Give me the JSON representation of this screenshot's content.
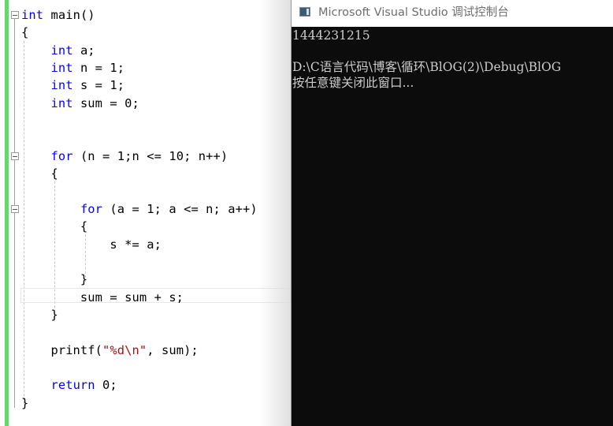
{
  "editor": {
    "lines": [
      {
        "id": "l1",
        "parts": [
          {
            "t": "int",
            "c": "kw"
          },
          {
            "t": " main()",
            "c": ""
          }
        ]
      },
      {
        "id": "l2",
        "parts": [
          {
            "t": "{",
            "c": ""
          }
        ]
      },
      {
        "id": "l3",
        "parts": [
          {
            "t": "    ",
            "c": ""
          },
          {
            "t": "int",
            "c": "kw"
          },
          {
            "t": " a;",
            "c": ""
          }
        ]
      },
      {
        "id": "l4",
        "parts": [
          {
            "t": "    ",
            "c": ""
          },
          {
            "t": "int",
            "c": "kw"
          },
          {
            "t": " n = 1;",
            "c": ""
          }
        ]
      },
      {
        "id": "l5",
        "parts": [
          {
            "t": "    ",
            "c": ""
          },
          {
            "t": "int",
            "c": "kw"
          },
          {
            "t": " s = 1;",
            "c": ""
          }
        ]
      },
      {
        "id": "l6",
        "parts": [
          {
            "t": "    ",
            "c": ""
          },
          {
            "t": "int",
            "c": "kw"
          },
          {
            "t": " sum = 0;",
            "c": ""
          }
        ]
      },
      {
        "id": "l7",
        "parts": []
      },
      {
        "id": "l8",
        "parts": []
      },
      {
        "id": "l9",
        "parts": [
          {
            "t": "    ",
            "c": ""
          },
          {
            "t": "for",
            "c": "kw"
          },
          {
            "t": " (n = 1;n <= 10; n++)",
            "c": ""
          }
        ]
      },
      {
        "id": "l10",
        "parts": [
          {
            "t": "    {",
            "c": ""
          }
        ]
      },
      {
        "id": "l11",
        "parts": []
      },
      {
        "id": "l12",
        "parts": [
          {
            "t": "        ",
            "c": ""
          },
          {
            "t": "for",
            "c": "kw"
          },
          {
            "t": " (a = 1; a <= n; a++)",
            "c": ""
          }
        ]
      },
      {
        "id": "l13",
        "parts": [
          {
            "t": "        {",
            "c": ""
          }
        ]
      },
      {
        "id": "l14",
        "parts": [
          {
            "t": "            s *= a;",
            "c": ""
          }
        ]
      },
      {
        "id": "l15",
        "parts": []
      },
      {
        "id": "l16",
        "parts": [
          {
            "t": "        }",
            "c": ""
          }
        ]
      },
      {
        "id": "l17",
        "parts": [
          {
            "t": "        sum = sum + s;",
            "c": ""
          }
        ]
      },
      {
        "id": "l18",
        "parts": [
          {
            "t": "    }",
            "c": ""
          }
        ]
      },
      {
        "id": "l19",
        "parts": []
      },
      {
        "id": "l20",
        "parts": [
          {
            "t": "    printf(",
            "c": ""
          },
          {
            "t": "\"%d\\n\"",
            "c": "str"
          },
          {
            "t": ", sum);",
            "c": ""
          }
        ]
      },
      {
        "id": "l21",
        "parts": []
      },
      {
        "id": "l22",
        "parts": [
          {
            "t": "    ",
            "c": ""
          },
          {
            "t": "return",
            "c": "kw"
          },
          {
            "t": " 0;",
            "c": ""
          }
        ]
      },
      {
        "id": "l23",
        "parts": [
          {
            "t": "}",
            "c": ""
          }
        ]
      }
    ],
    "colors": {
      "keyword": "#0000ff",
      "string": "#a31515",
      "change_bar": "#6bd46a"
    }
  },
  "console": {
    "title": "Microsoft Visual Studio 调试控制台",
    "output": [
      "1444231215",
      "",
      "D:\\C语言代码\\博客\\循环\\BlOG(2)\\Debug\\BlOG",
      "按任意键关闭此窗口..."
    ]
  }
}
